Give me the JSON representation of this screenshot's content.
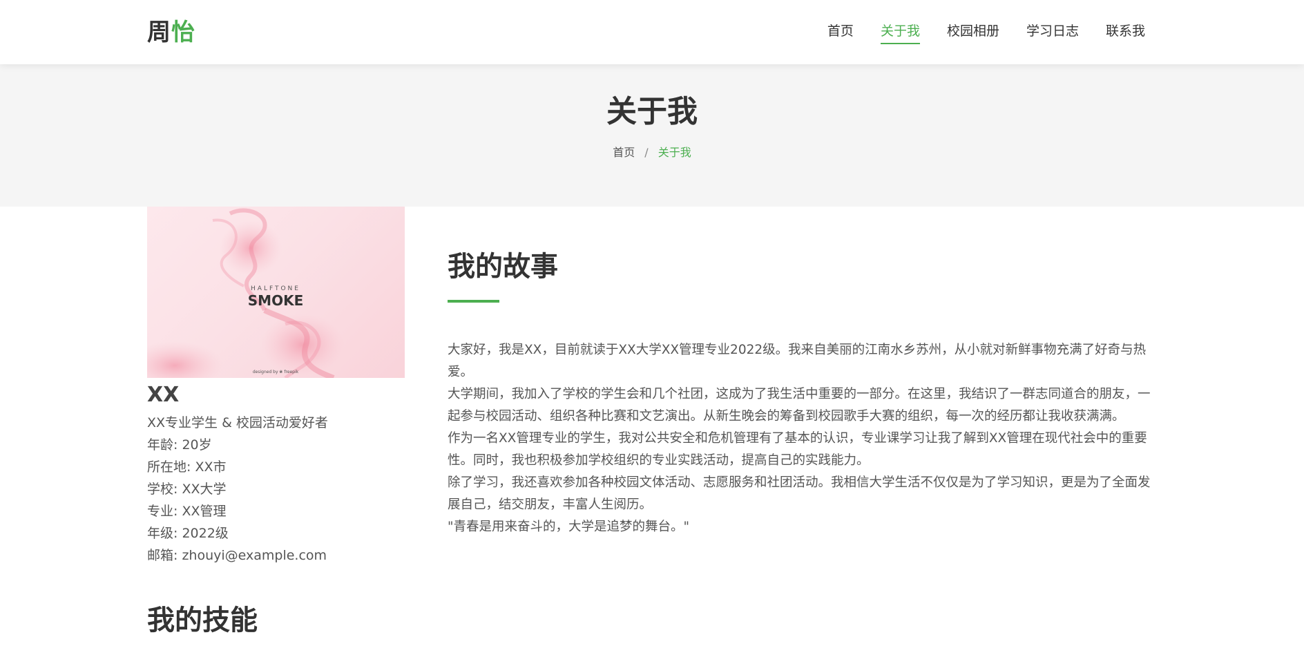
{
  "logo": {
    "part1": "周",
    "part2": "怡"
  },
  "nav": {
    "items": [
      {
        "label": "首页"
      },
      {
        "label": "关于我"
      },
      {
        "label": "校园相册"
      },
      {
        "label": "学习日志"
      },
      {
        "label": "联系我"
      }
    ],
    "active_index": 1
  },
  "banner": {
    "title": "关于我",
    "breadcrumb": {
      "home": "首页",
      "separator": "/",
      "current": "关于我"
    }
  },
  "profile": {
    "image": {
      "top_text": "HALFTONE",
      "main_text": "SMOKE",
      "credit": "designed by ❀ freepik"
    },
    "name": "XX",
    "tagline": "XX专业学生 & 校园活动爱好者",
    "age": "年龄: 20岁",
    "location": "所在地: XX市",
    "school": "学校: XX大学",
    "major": "专业: XX管理",
    "grade": "年级: 2022级",
    "email": "邮箱: zhouyi@example.com"
  },
  "story": {
    "title": "我的故事",
    "paragraphs": [
      "大家好，我是XX，目前就读于XX大学XX管理专业2022级。我来自美丽的江南水乡苏州，从小就对新鲜事物充满了好奇与热爱。",
      "大学期间，我加入了学校的学生会和几个社团，这成为了我生活中重要的一部分。在这里，我结识了一群志同道合的朋友，一起参与校园活动、组织各种比赛和文艺演出。从新生晚会的筹备到校园歌手大赛的组织，每一次的经历都让我收获满满。",
      "作为一名XX管理专业的学生，我对公共安全和危机管理有了基本的认识，专业课学习让我了解到XX管理在现代社会中的重要性。同时，我也积极参加学校组织的专业实践活动，提高自己的实践能力。",
      "除了学习，我还喜欢参加各种校园文体活动、志愿服务和社团活动。我相信大学生活不仅仅是为了学习知识，更是为了全面发展自己，结交朋友，丰富人生阅历。",
      "\"青春是用来奋斗的，大学是追梦的舞台。\""
    ]
  },
  "skills": {
    "title": "我的技能"
  },
  "colors": {
    "accent": "#4caf50",
    "text": "#333333",
    "muted": "#555555",
    "banner_bg": "#f5f5f5"
  }
}
